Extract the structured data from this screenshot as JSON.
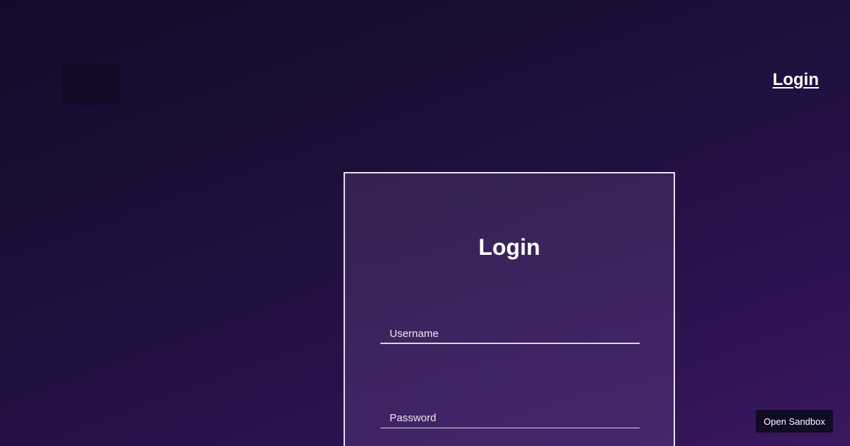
{
  "header": {
    "login_link": "Login"
  },
  "login_card": {
    "title": "Login",
    "username_placeholder": "Username",
    "password_placeholder": "Password"
  },
  "sandbox": {
    "label": "Open Sandbox"
  },
  "colors": {
    "background_dark": "#140b2a",
    "background_light": "#3a1860",
    "card_border": "#e6e1ee",
    "button_bg": "#110b24",
    "text": "#ffffff"
  }
}
